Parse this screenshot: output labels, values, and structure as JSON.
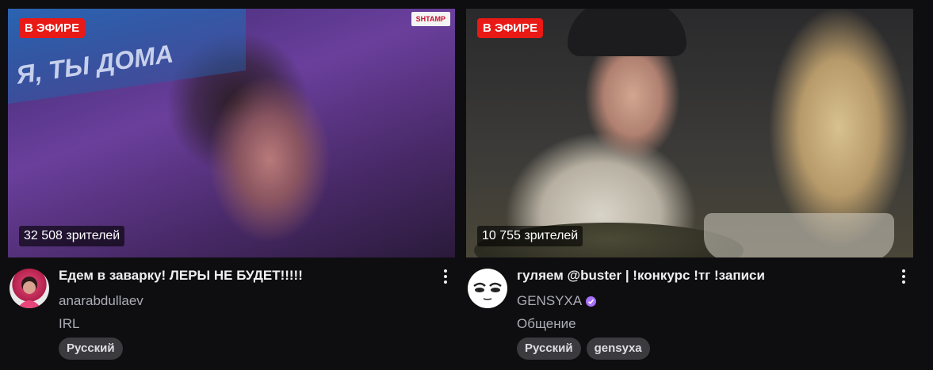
{
  "colors": {
    "live_badge": "#e91916",
    "background": "#0e0e10",
    "tag_background": "#3b3b3f",
    "verified": "#a970ff"
  },
  "streams": [
    {
      "live_label": "В ЭФИРЕ",
      "viewers": "32 508 зрителей",
      "title": "Едем в заварку! ЛЕРЫ НЕ БУДЕТ!!!!!",
      "channel": "anarabdullaev",
      "category": "IRL",
      "tags": [
        "Русский"
      ],
      "thumbnail_overlay_text": "Я, ТЫ ДОМА",
      "thumbnail_logo_text": "SHTAMP",
      "verified": false
    },
    {
      "live_label": "В ЭФИРЕ",
      "viewers": "10 755 зрителей",
      "title": "гуляем @buster | !конкурс !тг !записи",
      "channel": "GENSYXA",
      "category": "Общение",
      "tags": [
        "Русский",
        "gensyxa"
      ],
      "verified": true
    }
  ],
  "icons": {
    "more_options": "vertical-ellipsis",
    "verified": "check-badge"
  }
}
